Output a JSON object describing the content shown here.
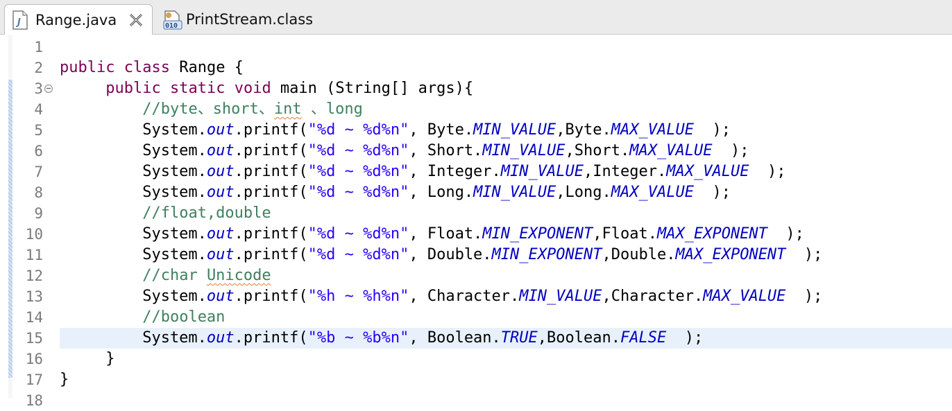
{
  "tabs": [
    {
      "label": "Range.java",
      "icon": "java-file-icon",
      "active": true
    },
    {
      "label": "PrintStream.class",
      "icon": "class-file-icon",
      "active": false
    }
  ],
  "editor": {
    "line_numbers": [
      "1",
      "2",
      "3",
      "4",
      "5",
      "6",
      "7",
      "8",
      "9",
      "10",
      "11",
      "12",
      "13",
      "14",
      "15",
      "16",
      "17",
      "18"
    ],
    "lines": [
      "",
      "public class Range {",
      "     public static void main (String[] args){",
      "         //byte、short、int 、long",
      "         System.out.printf(\"%d ~ %d%n\", Byte.MIN_VALUE,Byte.MAX_VALUE  );",
      "         System.out.printf(\"%d ~ %d%n\", Short.MIN_VALUE,Short.MAX_VALUE  );",
      "         System.out.printf(\"%d ~ %d%n\", Integer.MIN_VALUE,Integer.MAX_VALUE  );",
      "         System.out.printf(\"%d ~ %d%n\", Long.MIN_VALUE,Long.MAX_VALUE  );",
      "         //float,double",
      "         System.out.printf(\"%d ~ %d%n\", Float.MIN_EXPONENT,Float.MAX_EXPONENT  );",
      "         System.out.printf(\"%d ~ %d%n\", Double.MIN_EXPONENT,Double.MAX_EXPONENT  );",
      "         //char Unicode",
      "         System.out.printf(\"%h ~ %h%n\", Character.MIN_VALUE,Character.MAX_VALUE  );",
      "         //boolean",
      "         System.out.printf(\"%b ~ %b%n\", Boolean.TRUE,Boolean.FALSE  );",
      "     }",
      "}",
      ""
    ],
    "current_line": "15",
    "colors": {
      "keyword": "#7f0055",
      "comment": "#3f7f5f",
      "string": "#2a00ff",
      "field": "#0000c0",
      "current_line": "#e8f1fb"
    }
  }
}
